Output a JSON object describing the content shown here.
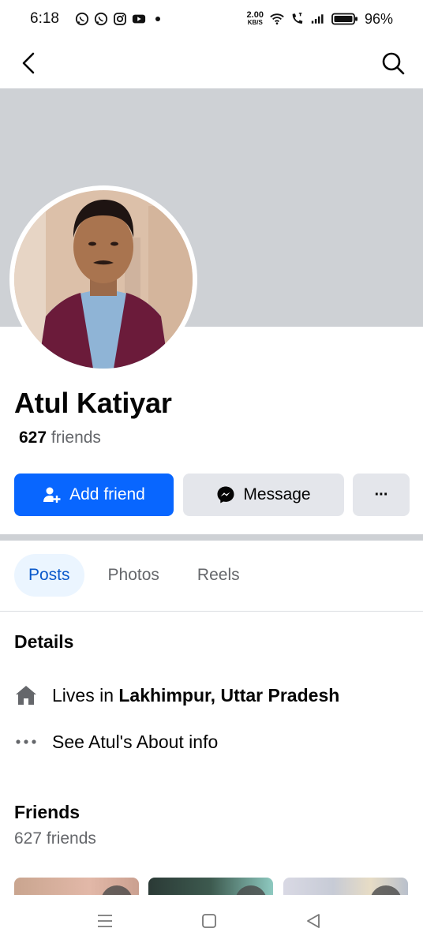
{
  "status_bar": {
    "time": "6:18",
    "net_speed_value": "2.00",
    "net_speed_unit": "KB/S",
    "battery": "96%",
    "left_icons": [
      "whatsapp-icon",
      "whatsapp-icon",
      "instagram-icon",
      "youtube-icon",
      "dot"
    ],
    "right_icons": [
      "wifi-icon",
      "call-icon",
      "signal-icon",
      "battery-icon"
    ]
  },
  "profile": {
    "name": "Atul Katiyar",
    "friends_number": "627",
    "friends_label": "friends"
  },
  "actions": {
    "add_friend": "Add friend",
    "message": "Message",
    "more": "···"
  },
  "tabs": [
    {
      "label": "Posts",
      "active": true
    },
    {
      "label": "Photos",
      "active": false
    },
    {
      "label": "Reels",
      "active": false
    }
  ],
  "details": {
    "title": "Details",
    "lives_prefix": "Lives in",
    "lives_place": "Lakhimpur, Uttar Pradesh",
    "about": "See Atul's About info"
  },
  "friends_section": {
    "title": "Friends",
    "count": "627 friends"
  },
  "colors": {
    "accent": "#0866ff",
    "cover": "#ced1d5",
    "secondary_button": "#e4e6eb",
    "active_tab_bg": "#ebf5ff"
  }
}
